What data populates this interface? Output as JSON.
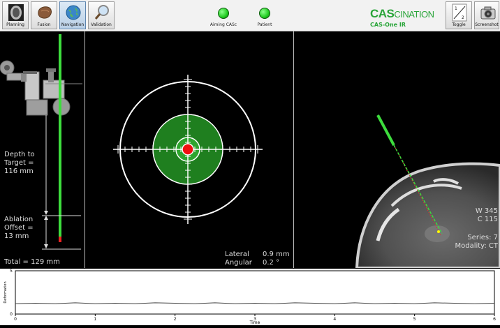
{
  "toolbar": {
    "planning_label": "Planning",
    "fusion_label": "Fusion",
    "navigation_label": "Navigation",
    "validation_label": "Validation",
    "toggle_label": "Toggle",
    "toggle_top": "1",
    "toggle_bottom": "2",
    "screenshot_label": "Screenshot"
  },
  "status": {
    "aiming_label": "Aiming CASc",
    "patient_label": "Patient",
    "indicator_color": "#22cc22"
  },
  "brand": {
    "cas": "CAS",
    "cination": "CINATION",
    "product": "CAS-One IR",
    "color": "#2aa53a"
  },
  "needle_panel": {
    "depth_line1": "Depth to",
    "depth_line2": "Target =",
    "depth_value": "116 mm",
    "ablation_line1": "Ablation",
    "ablation_line2": "Offset =",
    "ablation_value": "13 mm",
    "total": "Total = 129 mm"
  },
  "target_panel": {
    "lateral_label": "Lateral",
    "lateral_value": "0.9 mm",
    "angular_label": "Angular",
    "angular_value": "0.2 °"
  },
  "ct_panel": {
    "window": "W 345",
    "center": "C 115",
    "series": "Series: 7",
    "modality": "Modality: CT"
  },
  "chart_data": {
    "type": "line",
    "title": "",
    "xlabel": "Time",
    "ylabel": "Deformation",
    "xlim": [
      0,
      6
    ],
    "ylim": [
      0,
      5
    ],
    "x_ticks": [
      "0",
      "1",
      "2",
      "3",
      "4",
      "5",
      "6"
    ],
    "y_ticks": [
      "0",
      "5"
    ],
    "series": [
      {
        "x": [
          0,
          0.25,
          0.5,
          0.75,
          1,
          1.25,
          1.5,
          1.75,
          2,
          2.25,
          2.5,
          2.75,
          3,
          3.25,
          3.5,
          3.75,
          4,
          4.25,
          4.5,
          4.75,
          5,
          5.25,
          5.5,
          5.75,
          6
        ],
        "values": [
          1.2,
          1.25,
          1.2,
          1.3,
          1.2,
          1.25,
          1.2,
          1.3,
          1.25,
          1.2,
          1.3,
          1.2,
          1.25,
          1.2,
          1.3,
          1.25,
          1.2,
          1.3,
          1.2,
          1.25,
          1.2,
          1.3,
          1.25,
          1.2,
          1.25
        ]
      }
    ]
  }
}
